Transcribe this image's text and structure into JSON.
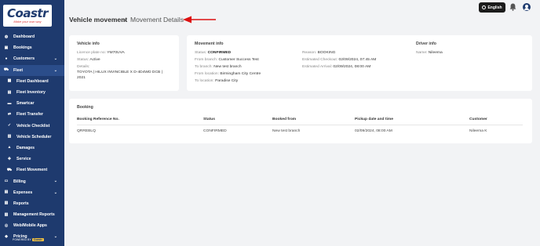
{
  "sidebar": {
    "logo": {
      "text": "Coastr",
      "tagline": "Make your own way"
    },
    "items": [
      {
        "label": "Dashboard",
        "icon": "dashboard-icon",
        "glyph": "◍",
        "chevron": false,
        "sub": false,
        "active": false
      },
      {
        "label": "Bookings",
        "icon": "bookings-icon",
        "glyph": "▣",
        "chevron": false,
        "sub": false,
        "active": false
      },
      {
        "label": "Customers",
        "icon": "customers-icon",
        "glyph": "●",
        "chevron": true,
        "sub": false,
        "active": false
      },
      {
        "label": "Fleet",
        "icon": "fleet-icon",
        "glyph": "⛟",
        "chevron": true,
        "sub": false,
        "active": true
      },
      {
        "label": "Fleet Dashboard",
        "icon": "fleet-dashboard-icon",
        "glyph": "▦",
        "chevron": false,
        "sub": true,
        "active": false
      },
      {
        "label": "Fleet Inventory",
        "icon": "fleet-inventory-icon",
        "glyph": "▤",
        "chevron": false,
        "sub": true,
        "active": false
      },
      {
        "label": "Smartcar",
        "icon": "smartcar-icon",
        "glyph": "▬",
        "chevron": false,
        "sub": true,
        "active": false
      },
      {
        "label": "Fleet Transfer",
        "icon": "fleet-transfer-icon",
        "glyph": "⇄",
        "chevron": false,
        "sub": true,
        "active": false
      },
      {
        "label": "Vehicle Checklist",
        "icon": "vehicle-checklist-icon",
        "glyph": "✓",
        "chevron": false,
        "sub": true,
        "active": false
      },
      {
        "label": "Vehicle Scheduler",
        "icon": "vehicle-scheduler-icon",
        "glyph": "▥",
        "chevron": false,
        "sub": true,
        "active": false
      },
      {
        "label": "Damages",
        "icon": "damages-icon",
        "glyph": "▲",
        "chevron": false,
        "sub": true,
        "active": false
      },
      {
        "label": "Service",
        "icon": "service-icon",
        "glyph": "✚",
        "chevron": false,
        "sub": true,
        "active": false
      },
      {
        "label": "Fleet Movement",
        "icon": "fleet-movement-icon",
        "glyph": "⛟",
        "chevron": false,
        "sub": true,
        "active": false
      },
      {
        "label": "Billing",
        "icon": "billing-icon",
        "glyph": "▭",
        "chevron": true,
        "sub": false,
        "active": false
      },
      {
        "label": "Expenses",
        "icon": "expenses-icon",
        "glyph": "▤",
        "chevron": true,
        "sub": false,
        "active": false
      },
      {
        "label": "Reports",
        "icon": "reports-icon",
        "glyph": "▧",
        "chevron": false,
        "sub": false,
        "active": false
      },
      {
        "label": "Management Reports",
        "icon": "management-reports-icon",
        "glyph": "▨",
        "chevron": false,
        "sub": false,
        "active": false
      },
      {
        "label": "Web/Mobile Apps",
        "icon": "web-mobile-apps-icon",
        "glyph": "◎",
        "chevron": false,
        "sub": false,
        "active": false
      },
      {
        "label": "Pricing",
        "icon": "pricing-icon",
        "glyph": "◆",
        "chevron": true,
        "sub": false,
        "active": false
      }
    ],
    "powered_by": {
      "prefix": "POWERED BY",
      "brand": "Coastr"
    }
  },
  "topbar": {
    "language": "English"
  },
  "header": {
    "title": "Vehicle movement",
    "separator": "»",
    "current": "Movement Details"
  },
  "vehicle_info": {
    "title": "Vehicle info",
    "licence_label": "Licence plate no:",
    "licence_value": "YM70UVA",
    "status_label": "Status:",
    "status_value": "Active",
    "details_label": "Details:",
    "details_line1": "TOYOTA | HILUX INVINCIBLE X D-4D4WD DCB |",
    "details_line2": "2021"
  },
  "movement_info": {
    "title": "Movement info",
    "status_label": "Status:",
    "status_value": "CONFIRMED",
    "from_branch_label": "From branch:",
    "from_branch_value": "Customer Success Test",
    "to_branch_label": "To branch:",
    "to_branch_value": "New test branch",
    "from_location_label": "From location:",
    "from_location_value": "Birmingham City Centre",
    "to_location_label": "To location:",
    "to_location_value": "Paradise City",
    "reason_label": "Reason:",
    "reason_value": "BOOKING",
    "est_checkout_label": "Estimated Checkout:",
    "est_checkout_value": "02/09/2024, 07:45 AM",
    "est_arrival_label": "Estimated Arrival:",
    "est_arrival_value": "02/09/2024, 08:00 AM"
  },
  "driver_info": {
    "title": "Driver info",
    "name_label": "Name:",
    "name_value": "Nileema"
  },
  "booking": {
    "title": "Booking",
    "columns": [
      "Booking Reference No.",
      "Status",
      "Booked from",
      "Pickup date and time",
      "Customer"
    ],
    "rows": [
      [
        "QRREBLQ",
        "CONFIRMED",
        "New test branch",
        "02/09/2024, 08:00 AM",
        "Nileema K"
      ]
    ]
  }
}
